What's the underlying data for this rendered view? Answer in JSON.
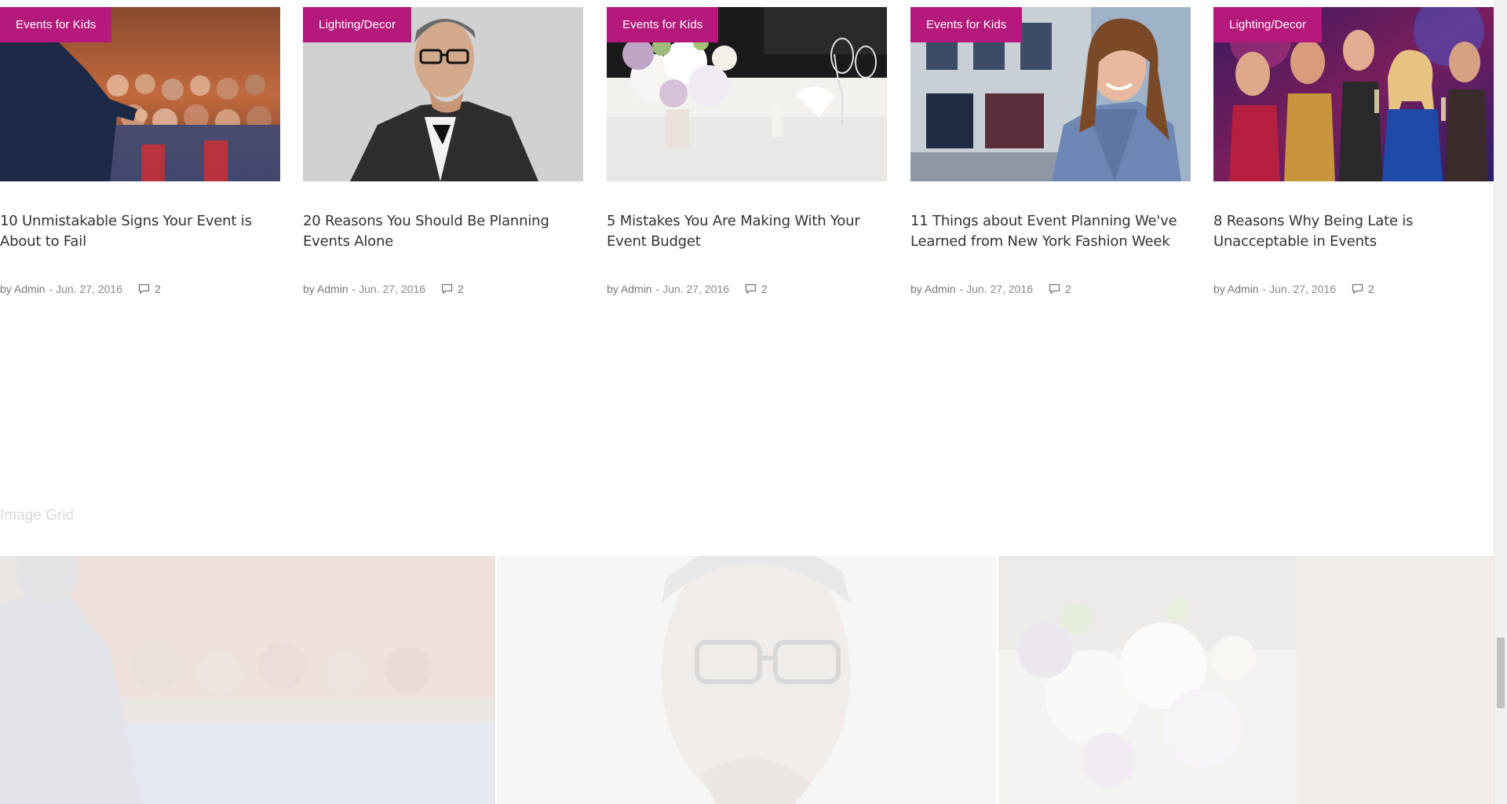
{
  "posts": [
    {
      "category": "Events for Kids",
      "title": "10 Unmistakable Signs Your Event is About to Fail",
      "author": "by Admin",
      "date": "- Jun. 27, 2016",
      "comments": "2"
    },
    {
      "category": "Lighting/Decor",
      "title": "20 Reasons You Should Be Planning Events Alone",
      "author": "by Admin",
      "date": "- Jun. 27, 2016",
      "comments": "2"
    },
    {
      "category": "Events for Kids",
      "title": "5 Mistakes You Are Making With Your Event Budget",
      "author": "by Admin",
      "date": "- Jun. 27, 2016",
      "comments": "2"
    },
    {
      "category": "Events for Kids",
      "title": "11 Things about Event Planning We've Learned from New York Fashion Week",
      "author": "by Admin",
      "date": "- Jun. 27, 2016",
      "comments": "2"
    },
    {
      "category": "Lighting/Decor",
      "title": "8 Reasons Why Being Late is Unacceptable in Events",
      "author": "by Admin",
      "date": "- Jun. 27, 2016",
      "comments": "2"
    }
  ],
  "image_grid": {
    "title": "Image Grid"
  },
  "colors": {
    "accent": "#b5197b",
    "title_text": "#333333",
    "meta_text": "#888888",
    "section_title": "#dadada"
  },
  "icons": {
    "comment": "comment-bubble-icon"
  }
}
